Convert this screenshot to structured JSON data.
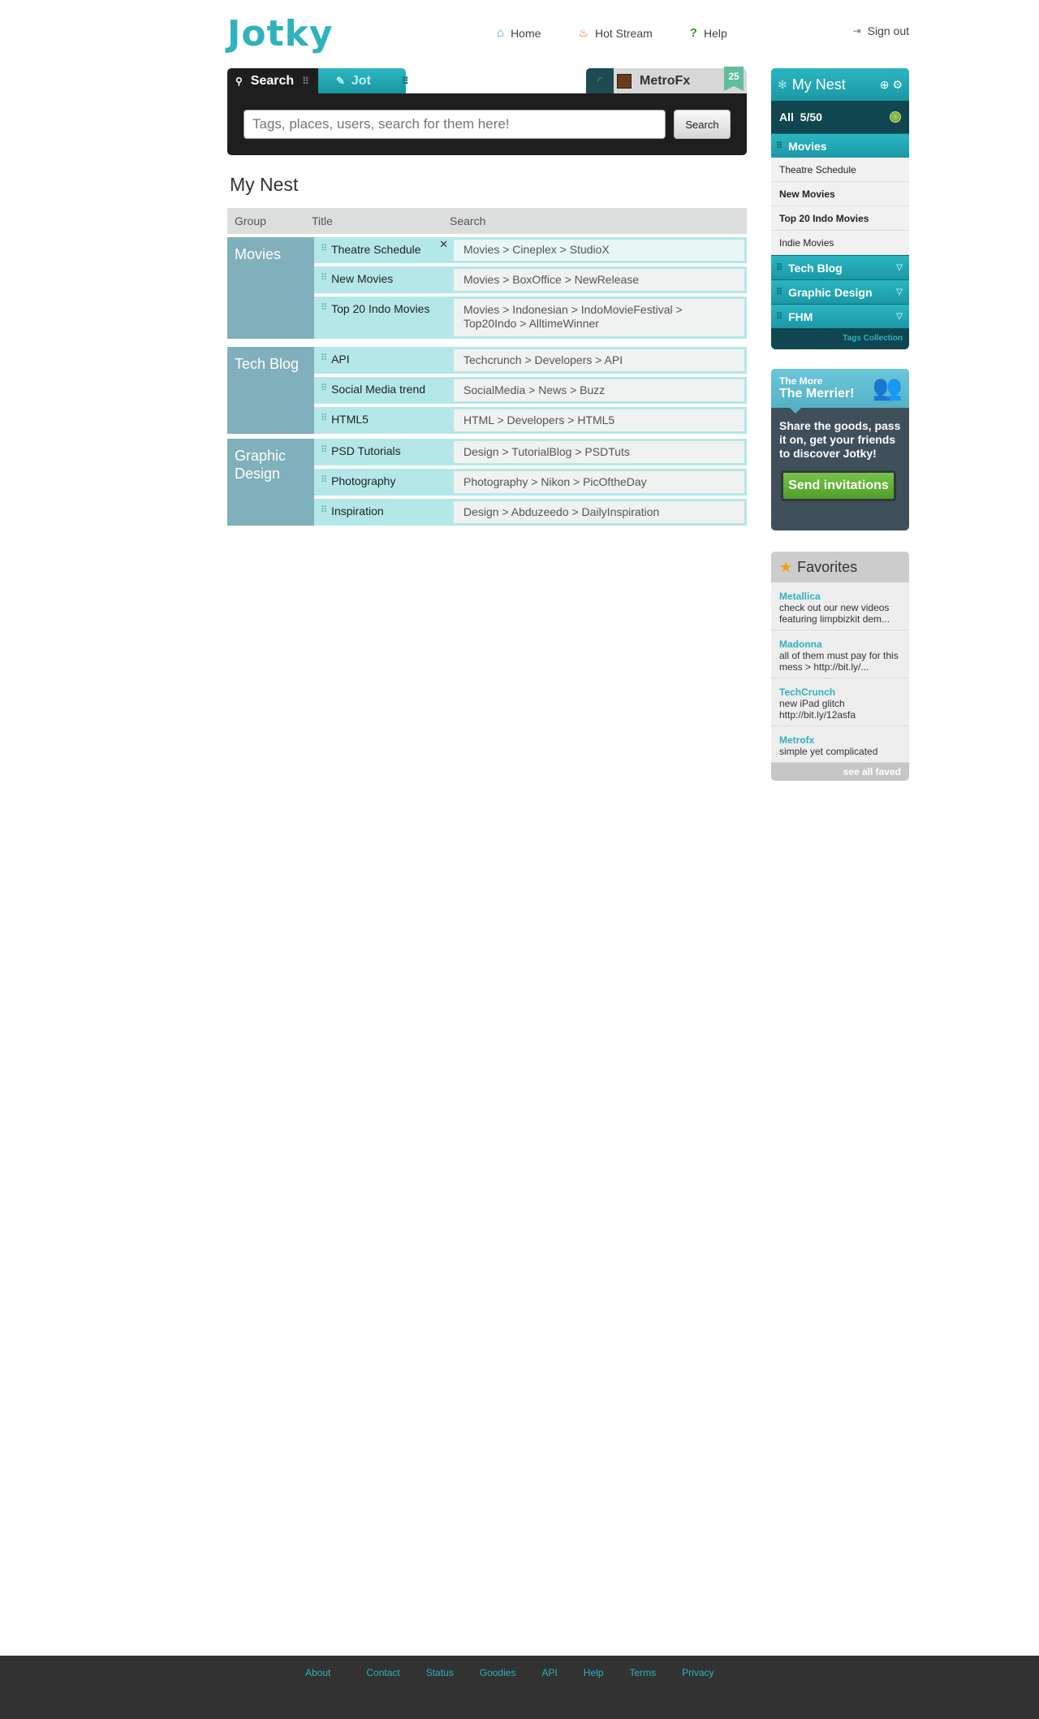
{
  "logo": "Jotky",
  "nav": [
    {
      "label": "Home",
      "icon": "home-icon"
    },
    {
      "label": "Hot Stream",
      "icon": "flame-icon"
    },
    {
      "label": "Help",
      "icon": "question-icon"
    }
  ],
  "signout": "Sign out",
  "search": {
    "tab_search": "Search",
    "tab_jot": "Jot",
    "user": "MetroFx",
    "badge": "25",
    "placeholder": "Tags, places, users, search for them here!",
    "button": "Search"
  },
  "nest": {
    "title": "My Nest",
    "headers": {
      "group": "Group",
      "title": "Title",
      "search": "Search"
    },
    "groups": [
      {
        "name": "Movies",
        "rows": [
          {
            "title": "Theatre Schedule",
            "search": "Movies  >  Cineplex  >  StudioX"
          },
          {
            "title": "New Movies",
            "search": "Movies  >  BoxOffice  >  NewRelease"
          },
          {
            "title": "Top 20 Indo Movies",
            "search": "Movies  >  Indonesian  >  IndoMovieFestival  >  Top20Indo  >  AlltimeWinner"
          }
        ]
      },
      {
        "name": "Tech Blog",
        "rows": [
          {
            "title": "API",
            "search": "Techcrunch  >  Developers  >  API"
          },
          {
            "title": "Social Media trend",
            "search": "SocialMedia  >  News  >  Buzz"
          },
          {
            "title": "HTML5",
            "search": "HTML  >  Developers  >  HTML5"
          }
        ]
      },
      {
        "name": "Graphic Design",
        "rows": [
          {
            "title": "PSD Tutorials",
            "search": "Design  >  TutorialBlog  >  PSDTuts"
          },
          {
            "title": "Photography",
            "search": "Photography  >  Nikon  >  PicOftheDay"
          },
          {
            "title": "Inspiration",
            "search": "Design  >  Abduzeedo  >  DailyInspiration"
          }
        ]
      }
    ]
  },
  "sidebar": {
    "title": "My Nest",
    "all": "All  5/50",
    "active_cat": "Movies",
    "items": [
      "Theatre Schedule",
      "New Movies",
      "Top 20 Indo Movies",
      "Indie Movies"
    ],
    "cats": [
      "Tech Blog",
      "Graphic Design",
      "FHM"
    ],
    "footer": "Tags Collection"
  },
  "invite": {
    "line1": "The More",
    "line2": "The Merrier!",
    "text": "Share the goods, pass it on, get your friends to discover Jotky!",
    "button": "Send invitations"
  },
  "favorites": {
    "title": "Favorites",
    "items": [
      {
        "who": "Metallica",
        "what": "check out our new videos featuring limpbizkit dem..."
      },
      {
        "who": "Madonna",
        "what": "all of them must pay for this mess > http://bit.ly/..."
      },
      {
        "who": "TechCrunch",
        "what": "new iPad glitch http://bit.ly/12asfa"
      },
      {
        "who": "Metrofx",
        "what": "simple yet complicated"
      }
    ],
    "footer": "see all faved"
  },
  "footer_links": [
    "About",
    "Contact",
    "Status",
    "Goodies",
    "API",
    "Help",
    "Terms",
    "Privacy"
  ]
}
